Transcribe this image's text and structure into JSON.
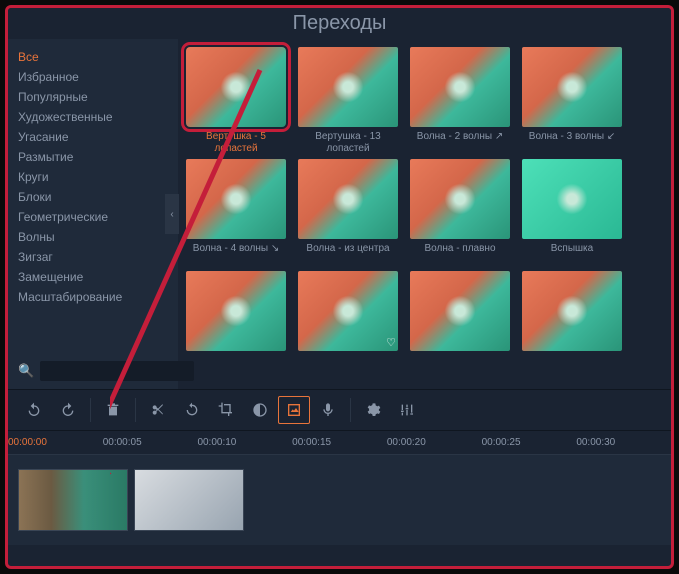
{
  "header": {
    "title": "Переходы"
  },
  "sidebar": {
    "categories": [
      {
        "label": "Все",
        "active": true
      },
      {
        "label": "Избранное"
      },
      {
        "label": "Популярные"
      },
      {
        "label": "Художественные"
      },
      {
        "label": "Угасание"
      },
      {
        "label": "Размытие"
      },
      {
        "label": "Круги"
      },
      {
        "label": "Блоки"
      },
      {
        "label": "Геометрические"
      },
      {
        "label": "Волны"
      },
      {
        "label": "Зигзаг"
      },
      {
        "label": "Замещение"
      },
      {
        "label": "Масштабирование"
      }
    ],
    "search_placeholder": ""
  },
  "transitions": {
    "row1": [
      {
        "label": "Вертушка - 5 лопастей",
        "selected": true
      },
      {
        "label": "Вертушка - 13 лопастей"
      },
      {
        "label": "Волна - 2 волны ↗"
      },
      {
        "label": "Волна - 3 волны ↙"
      }
    ],
    "row2": [
      {
        "label": "Волна - 4 волны ↘"
      },
      {
        "label": "Волна - из центра"
      },
      {
        "label": "Волна - плавно"
      },
      {
        "label": "Вспышка"
      }
    ]
  },
  "ruler": {
    "ticks": [
      "00:00:00",
      "00:00:05",
      "00:00:10",
      "00:00:15",
      "00:00:20",
      "00:00:25",
      "00:00:30"
    ]
  },
  "toolbar_icons": {
    "undo": "undo",
    "redo": "redo",
    "delete": "delete",
    "cut": "cut",
    "rotate": "rotate",
    "crop": "crop",
    "contrast": "contrast",
    "image": "image",
    "mic": "mic",
    "gear": "gear",
    "adjust": "adjust"
  }
}
